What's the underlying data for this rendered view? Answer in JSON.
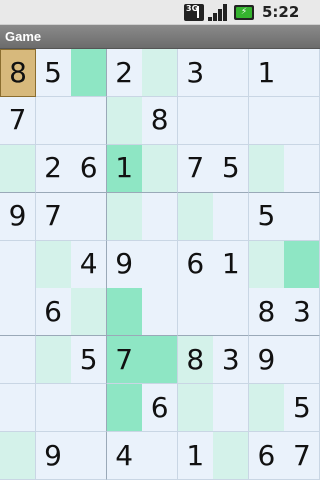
{
  "status_bar": {
    "time": "5:22 AM",
    "network_label": "3G",
    "battery_icon": "battery-charging-icon",
    "signal_icon": "signal-bars-icon"
  },
  "app": {
    "title": "Game"
  },
  "colors": {
    "base": "#eaf2fb",
    "light_green": "#d4f2ea",
    "green": "#8ee6c4",
    "selected": "#d7b97c"
  },
  "board": {
    "rows": [
      [
        {
          "v": "8",
          "c": "selected"
        },
        {
          "v": "5",
          "c": "base"
        },
        {
          "v": "",
          "c": "green"
        },
        {
          "v": "2",
          "c": "base"
        },
        {
          "v": "",
          "c": "light_green"
        },
        {
          "v": "3",
          "c": "base"
        },
        {
          "v": "",
          "c": "base"
        },
        {
          "v": "1",
          "c": "base"
        },
        {
          "v": "",
          "c": "base"
        }
      ],
      [
        {
          "v": "7",
          "c": "base"
        },
        {
          "v": "",
          "c": "base"
        },
        {
          "v": "",
          "c": "base"
        },
        {
          "v": "",
          "c": "light_green"
        },
        {
          "v": "8",
          "c": "base"
        },
        {
          "v": "",
          "c": "base"
        },
        {
          "v": "",
          "c": "base"
        },
        {
          "v": "",
          "c": "base"
        },
        {
          "v": "",
          "c": "base"
        }
      ],
      [
        {
          "v": "",
          "c": "light_green"
        },
        {
          "v": "2",
          "c": "base"
        },
        {
          "v": "6",
          "c": "base"
        },
        {
          "v": "1",
          "c": "green"
        },
        {
          "v": "",
          "c": "light_green"
        },
        {
          "v": "7",
          "c": "base"
        },
        {
          "v": "5",
          "c": "base"
        },
        {
          "v": "",
          "c": "light_green"
        },
        {
          "v": "",
          "c": "base"
        }
      ],
      [
        {
          "v": "9",
          "c": "base"
        },
        {
          "v": "7",
          "c": "base"
        },
        {
          "v": "",
          "c": "base"
        },
        {
          "v": "",
          "c": "light_green"
        },
        {
          "v": "",
          "c": "base"
        },
        {
          "v": "",
          "c": "light_green"
        },
        {
          "v": "",
          "c": "base"
        },
        {
          "v": "5",
          "c": "base"
        },
        {
          "v": "",
          "c": "base"
        }
      ],
      [
        {
          "v": "",
          "c": "base"
        },
        {
          "v": "",
          "c": "light_green"
        },
        {
          "v": "4",
          "c": "base"
        },
        {
          "v": "9",
          "c": "base"
        },
        {
          "v": "",
          "c": "base"
        },
        {
          "v": "6",
          "c": "base"
        },
        {
          "v": "1",
          "c": "base"
        },
        {
          "v": "",
          "c": "light_green"
        },
        {
          "v": "",
          "c": "green"
        }
      ],
      [
        {
          "v": "",
          "c": "base"
        },
        {
          "v": "6",
          "c": "base"
        },
        {
          "v": "",
          "c": "light_green"
        },
        {
          "v": "",
          "c": "green"
        },
        {
          "v": "",
          "c": "base"
        },
        {
          "v": "",
          "c": "base"
        },
        {
          "v": "",
          "c": "base"
        },
        {
          "v": "8",
          "c": "base"
        },
        {
          "v": "3",
          "c": "base"
        }
      ],
      [
        {
          "v": "",
          "c": "base"
        },
        {
          "v": "",
          "c": "light_green"
        },
        {
          "v": "5",
          "c": "base"
        },
        {
          "v": "7",
          "c": "green"
        },
        {
          "v": "",
          "c": "green"
        },
        {
          "v": "8",
          "c": "light_green"
        },
        {
          "v": "3",
          "c": "base"
        },
        {
          "v": "9",
          "c": "base"
        },
        {
          "v": "",
          "c": "base"
        }
      ],
      [
        {
          "v": "",
          "c": "base"
        },
        {
          "v": "",
          "c": "base"
        },
        {
          "v": "",
          "c": "base"
        },
        {
          "v": "",
          "c": "green"
        },
        {
          "v": "6",
          "c": "base"
        },
        {
          "v": "",
          "c": "light_green"
        },
        {
          "v": "",
          "c": "base"
        },
        {
          "v": "",
          "c": "light_green"
        },
        {
          "v": "5",
          "c": "base"
        }
      ],
      [
        {
          "v": "",
          "c": "light_green"
        },
        {
          "v": "9",
          "c": "base"
        },
        {
          "v": "",
          "c": "base"
        },
        {
          "v": "4",
          "c": "base"
        },
        {
          "v": "",
          "c": "base"
        },
        {
          "v": "1",
          "c": "base"
        },
        {
          "v": "",
          "c": "light_green"
        },
        {
          "v": "6",
          "c": "base"
        },
        {
          "v": "7",
          "c": "base"
        }
      ]
    ]
  }
}
